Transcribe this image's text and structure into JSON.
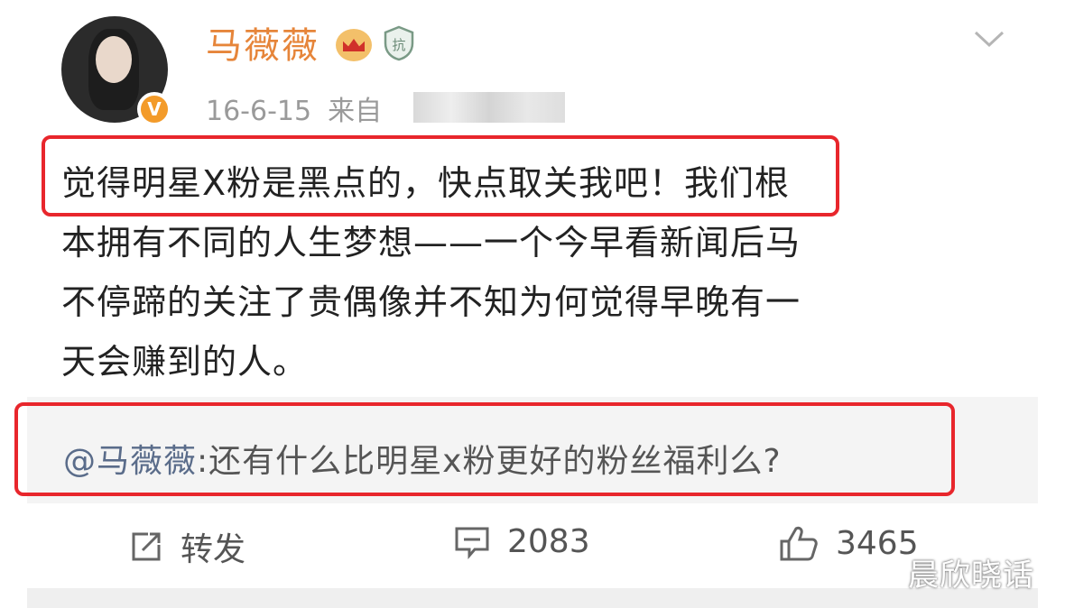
{
  "post": {
    "author": "马薇薇",
    "verified_badge": "V",
    "date": "16-6-15",
    "source_prefix": "来自",
    "highlight_text": "觉得明星X粉是黑点的，快点取关我吧！",
    "body_lines": [
      "觉得明星X粉是黑点的，快点取关我吧！我们根",
      "本拥有不同的人生梦想——一个今早看新闻后马",
      "不停蹄的关注了贵偶像并不知为何觉得早晚有一",
      "天会赚到的人。"
    ],
    "quote": {
      "mention": "@马薇薇",
      "text": ":还有什么比明星x粉更好的粉丝福利么?"
    }
  },
  "actions": {
    "repost_label": "转发",
    "comment_count": "2083",
    "like_count": "3465"
  },
  "watermark": "晨欣晓话",
  "icons": {
    "crown": "crown-badge-icon",
    "shield": "shield-badge-icon",
    "chevron": "chevron-down-icon",
    "repost": "repost-icon",
    "comment": "comment-icon",
    "like": "thumbs-up-icon"
  },
  "colors": {
    "username": "#e6853a",
    "highlight_border": "#e8262c",
    "verified": "#f39b2a"
  }
}
